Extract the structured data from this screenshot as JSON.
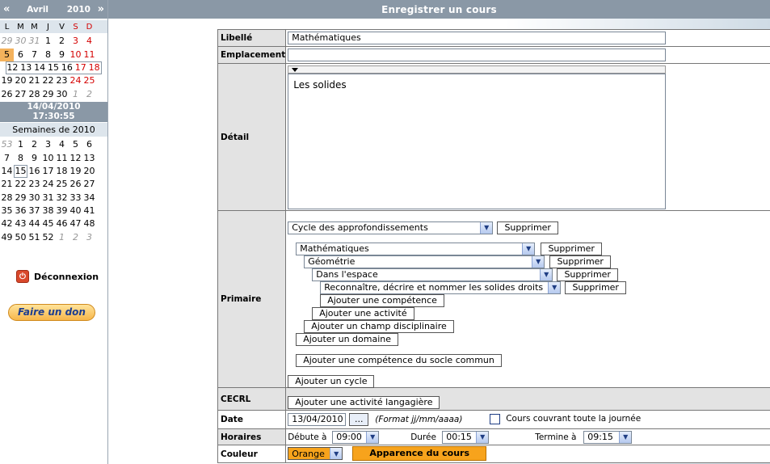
{
  "calendar": {
    "prev": "«",
    "month": "Avril",
    "year": "2010",
    "next": "»",
    "day_headers": [
      "L",
      "M",
      "M",
      "J",
      "V",
      "S",
      "D"
    ],
    "weeks": [
      [
        "29",
        "30",
        "31",
        "1",
        "2",
        "3",
        "4"
      ],
      [
        "5",
        "6",
        "7",
        "8",
        "9",
        "10",
        "11"
      ],
      [
        "12",
        "13",
        "14",
        "15",
        "16",
        "17",
        "18"
      ],
      [
        "19",
        "20",
        "21",
        "22",
        "23",
        "24",
        "25"
      ],
      [
        "26",
        "27",
        "28",
        "29",
        "30",
        "1",
        "2"
      ]
    ],
    "date": "14/04/2010",
    "time": "17:30:55"
  },
  "weeks_panel": {
    "title": "Semaines de 2010",
    "rows": [
      [
        "53",
        "1",
        "2",
        "3",
        "4",
        "5",
        "6"
      ],
      [
        "7",
        "8",
        "9",
        "10",
        "11",
        "12",
        "13"
      ],
      [
        "14",
        "15",
        "16",
        "17",
        "18",
        "19",
        "20"
      ],
      [
        "21",
        "22",
        "23",
        "24",
        "25",
        "26",
        "27"
      ],
      [
        "28",
        "29",
        "30",
        "31",
        "32",
        "33",
        "34"
      ],
      [
        "35",
        "36",
        "37",
        "38",
        "39",
        "40",
        "41"
      ],
      [
        "42",
        "43",
        "44",
        "45",
        "46",
        "47",
        "48"
      ],
      [
        "49",
        "50",
        "51",
        "52",
        "1",
        "2",
        "3"
      ]
    ]
  },
  "sidebar": {
    "logout": "Déconnexion",
    "donate": "Faire un don"
  },
  "header": {
    "title": "Enregistrer un cours"
  },
  "form": {
    "libelle_label": "Libellé",
    "libelle_value": "Mathématiques",
    "emplacement_label": "Emplacement",
    "emplacement_value": "",
    "detail_label": "Détail",
    "detail_value": "Les solides",
    "primaire_label": "Primaire",
    "cycle": "Cycle des approfondissements",
    "domaine": "Mathématiques",
    "champ": "Géométrie",
    "activite": "Dans l'espace",
    "competence": "Reconnaître, décrire et nommer les solides droits",
    "delete": "Supprimer",
    "add_competence": "Ajouter une compétence",
    "add_activite": "Ajouter une activité",
    "add_champ": "Ajouter un champ disciplinaire",
    "add_domaine": "Ajouter un domaine",
    "add_socle": "Ajouter une compétence du socle commun",
    "add_cycle": "Ajouter un cycle",
    "cecrl_label": "CECRL",
    "add_langagiere": "Ajouter une activité langagière",
    "date_label": "Date",
    "date_value": "13/04/2010",
    "date_picker": "...",
    "date_format": "(Format jj/mm/aaaa)",
    "allday": "Cours couvrant toute la journée",
    "horaires_label": "Horaires",
    "debut_label": "Débute à",
    "debut_value": "09:00",
    "duree_label": "Durée",
    "duree_value": "00:15",
    "fin_label": "Termine à",
    "fin_value": "09:15",
    "couleur_label": "Couleur",
    "couleur_value": "Orange",
    "apparence": "Apparence du cours"
  },
  "colors": {
    "accent": "#8a98a6",
    "orange": "#f7a31c",
    "today": "#f4b25c"
  }
}
